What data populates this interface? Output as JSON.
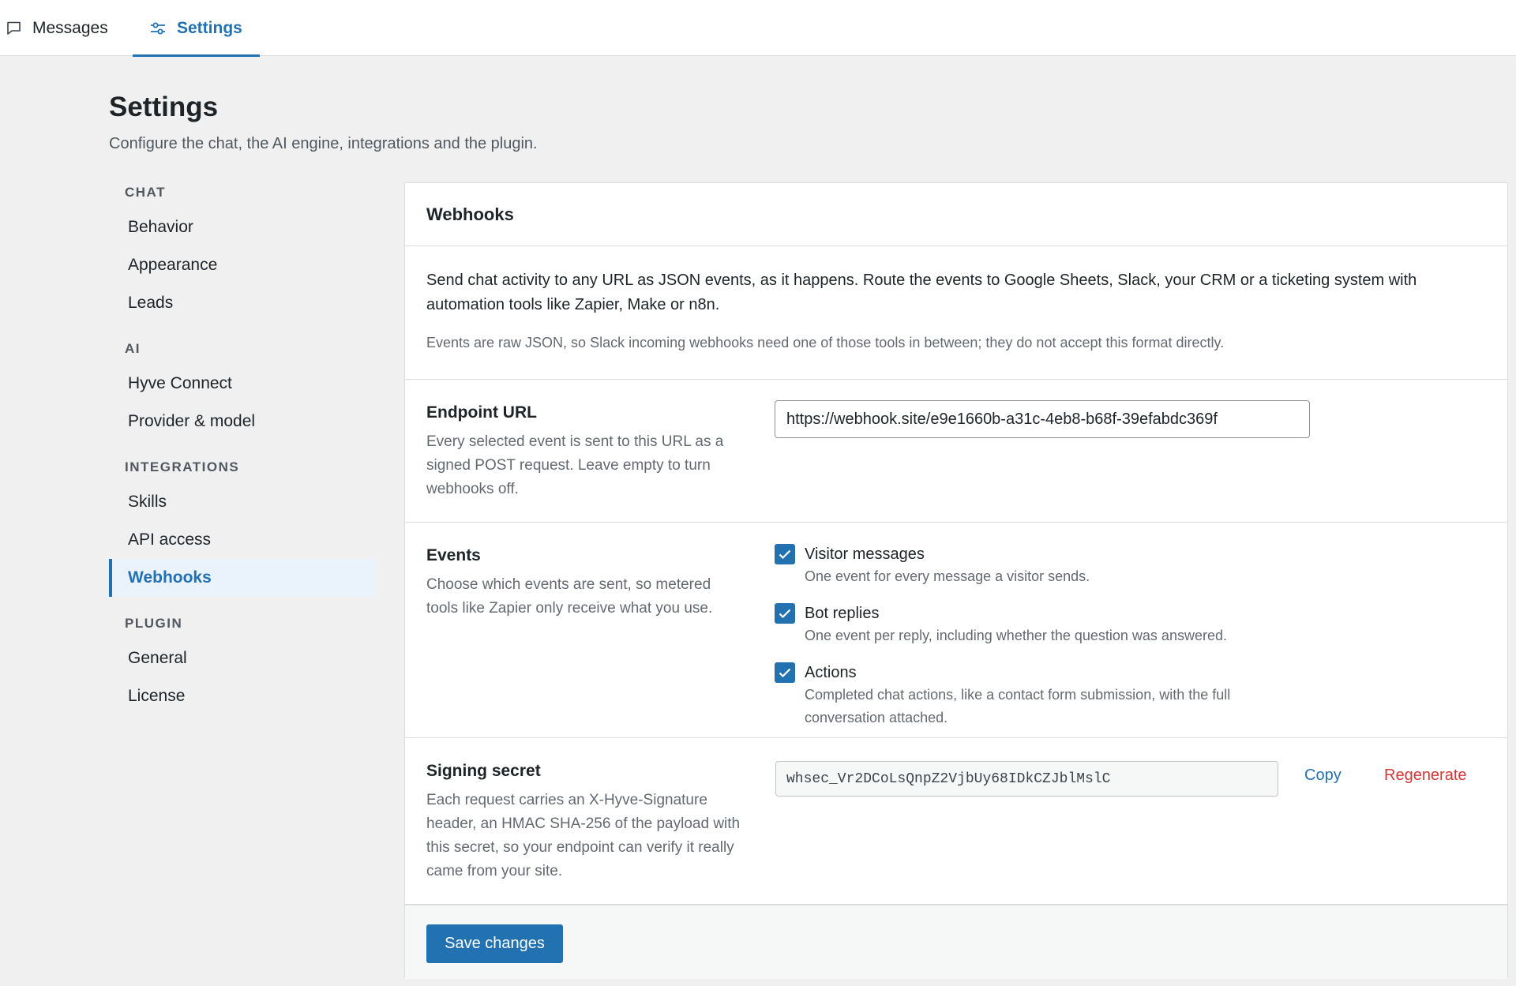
{
  "tabs": {
    "messages_label": "Messages",
    "settings_label": "Settings",
    "messages_icon": "chat-bubble-icon",
    "settings_icon": "sliders-icon",
    "active": "Settings"
  },
  "page": {
    "title": "Settings",
    "subtitle": "Configure the chat, the AI engine, integrations and the plugin."
  },
  "sidebar": {
    "groups": [
      {
        "heading": "CHAT",
        "items": [
          "Behavior",
          "Appearance",
          "Leads"
        ]
      },
      {
        "heading": "AI",
        "items": [
          "Hyve Connect",
          "Provider & model"
        ]
      },
      {
        "heading": "INTEGRATIONS",
        "items": [
          "Skills",
          "API access",
          "Webhooks"
        ]
      },
      {
        "heading": "PLUGIN",
        "items": [
          "General",
          "License"
        ]
      }
    ],
    "active_item": "Webhooks"
  },
  "panel": {
    "title": "Webhooks",
    "intro": "Send chat activity to any URL as JSON events, as it happens. Route the events to Google Sheets, Slack, your CRM or a ticketing system with automation tools like Zapier, Make or n8n.",
    "note": "Events are raw JSON, so Slack incoming webhooks need one of those tools in between; they do not accept this format directly.",
    "endpoint": {
      "label": "Endpoint URL",
      "description": "Every selected event is sent to this URL as a signed POST request. Leave empty to turn webhooks off.",
      "value": "https://webhook.site/e9e1660b-a31c-4eb8-b68f-39efabdc369f"
    },
    "events": {
      "label": "Events",
      "description": "Choose which events are sent, so metered tools like Zapier only receive what you use.",
      "options": [
        {
          "label": "Visitor messages",
          "hint": "One event for every message a visitor sends.",
          "checked": true
        },
        {
          "label": "Bot replies",
          "hint": "One event per reply, including whether the question was answered.",
          "checked": true
        },
        {
          "label": "Actions",
          "hint": "Completed chat actions, like a contact form submission, with the full conversation attached.",
          "checked": true
        }
      ]
    },
    "secret": {
      "label": "Signing secret",
      "description": "Each request carries an X-Hyve-Signature header, an HMAC SHA-256 of the payload with this secret, so your endpoint can verify it really came from your site.",
      "value": "whsec_Vr2DCoLsQnpZ2VjbUy68IDkCZJblMslC",
      "copy_label": "Copy",
      "regenerate_label": "Regenerate"
    },
    "save_label": "Save changes"
  },
  "colors": {
    "accent": "#2271b1",
    "danger": "#d63638",
    "background": "#f0f0f1"
  }
}
